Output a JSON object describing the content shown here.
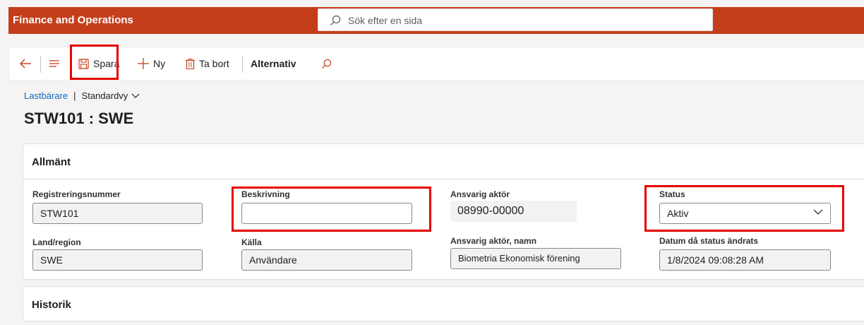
{
  "app": {
    "title": "Finance and Operations"
  },
  "search": {
    "placeholder": "Sök efter en sida"
  },
  "toolbar": {
    "save_label": "Spara",
    "new_label": "Ny",
    "delete_label": "Ta bort",
    "options_label": "Alternativ"
  },
  "breadcrumb": {
    "link": "Lastbärare",
    "separator": "|",
    "view": "Standardvy"
  },
  "page": {
    "title": "STW101 : SWE"
  },
  "general": {
    "heading": "Allmänt",
    "fields": {
      "reg_number": {
        "label": "Registreringsnummer",
        "value": "STW101"
      },
      "description": {
        "label": "Beskrivning",
        "value": ""
      },
      "responsible_actor": {
        "label": "Ansvarig aktör",
        "value": "08990-00000"
      },
      "status": {
        "label": "Status",
        "value": "Aktiv"
      },
      "country": {
        "label": "Land/region",
        "value": "SWE"
      },
      "source": {
        "label": "Källa",
        "value": "Användare"
      },
      "responsible_actor_name": {
        "label": "Ansvarig aktör, namn",
        "value": "Biometria Ekonomisk förening"
      },
      "status_changed": {
        "label": "Datum då status ändrats",
        "value": "1/8/2024 09:08:28 AM"
      }
    }
  },
  "history": {
    "heading": "Historik"
  },
  "colors": {
    "brand": "#c43e1c",
    "highlight": "#e60000",
    "link": "#0f6cbd"
  }
}
